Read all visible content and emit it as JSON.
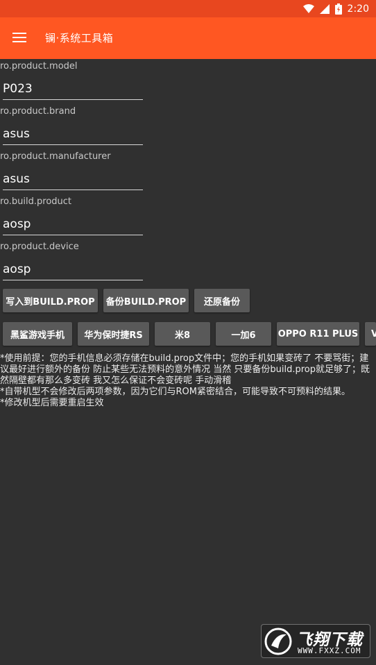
{
  "status_bar": {
    "time": "2:20",
    "icons": [
      "wifi-icon",
      "signal-icon",
      "battery-icon"
    ]
  },
  "app_bar": {
    "title": "镧·系统工具箱",
    "menu_icon": "hamburger-menu-icon"
  },
  "fields": [
    {
      "label": "ro.product.model",
      "value": "P023"
    },
    {
      "label": "ro.product.brand",
      "value": "asus"
    },
    {
      "label": "ro.product.manufacturer",
      "value": "asus"
    },
    {
      "label": "ro.build.product",
      "value": "aosp"
    },
    {
      "label": "ro.product.device",
      "value": "aosp"
    }
  ],
  "actions": {
    "write": "写入到BUILD.PROP",
    "backup": "备份BUILD.PROP",
    "restore": "还原备份"
  },
  "presets": [
    "黑鲨游戏手机",
    "华为保时捷RS",
    "米8",
    "一加6",
    "OPPO R11 PLUS",
    "V"
  ],
  "info": {
    "line1": "*使用前提：您的手机信息必须存储在build.prop文件中；您的手机如果变砖了 不要骂街；建议最好进行额外的备份 防止某些无法预料的意外情况 当然 只要备份build.prop就足够了；既然隔壁都有那么多变砖 我又怎么保证不会变砖呢 手动滑稽",
    "line2": "*自带机型不会修改后两项参数，因为它们与ROM紧密结合，可能导致不可预料的结果。",
    "line3": "*修改机型后需要重启生效"
  },
  "watermark": {
    "text": "飞翔下载",
    "url": "WWW.FXXZ.COM"
  },
  "colors": {
    "status_bar": "#e8471f",
    "app_bar": "#ff5722",
    "background": "#303030",
    "button": "#595959"
  }
}
